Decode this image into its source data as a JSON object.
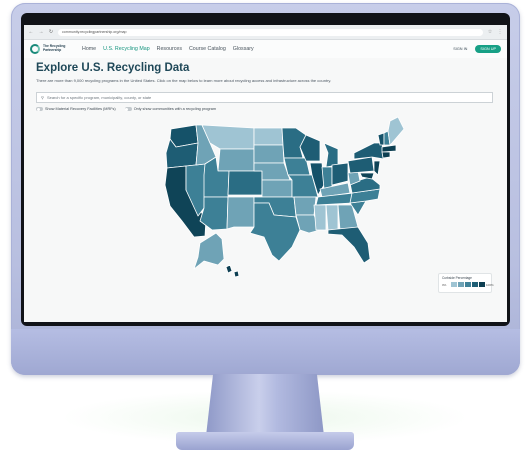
{
  "browser": {
    "url": "community.recyclingpartnership.org/map"
  },
  "header": {
    "logo_line1": "The Recycling",
    "logo_line2": "Partnership",
    "logo_line3": "",
    "nav": [
      {
        "label": "Home",
        "active": false
      },
      {
        "label": "U.S. Recycling Map",
        "active": true
      },
      {
        "label": "Resources",
        "active": false
      },
      {
        "label": "Course Catalog",
        "active": false
      },
      {
        "label": "Glossary",
        "active": false
      }
    ],
    "signin_label": "SIGN IN",
    "signup_label": "SIGN UP"
  },
  "main": {
    "title": "Explore U.S. Recycling Data",
    "intro": "There are more than 9,000 recycling programs in the United States. Click on the map below to learn more about recycling access and infrastructure across the country.",
    "search_placeholder": "Search for a specific program, municipality, county, or state",
    "toggles": [
      {
        "label": "Show Material Recovery Facilities (MRFs)",
        "on": false
      },
      {
        "label": "Only show communities with a recycling program",
        "on": false
      }
    ]
  },
  "legend": {
    "title": "Curbside Percentage",
    "low_label": "0%",
    "high_label": "100%",
    "colors": [
      "#cfe1ea",
      "#9fc4d3",
      "#6fa3b6",
      "#3f8299",
      "#1f5f76",
      "#0d3f52"
    ]
  },
  "colors": {
    "accent": "#16957f",
    "title": "#1f4858"
  }
}
